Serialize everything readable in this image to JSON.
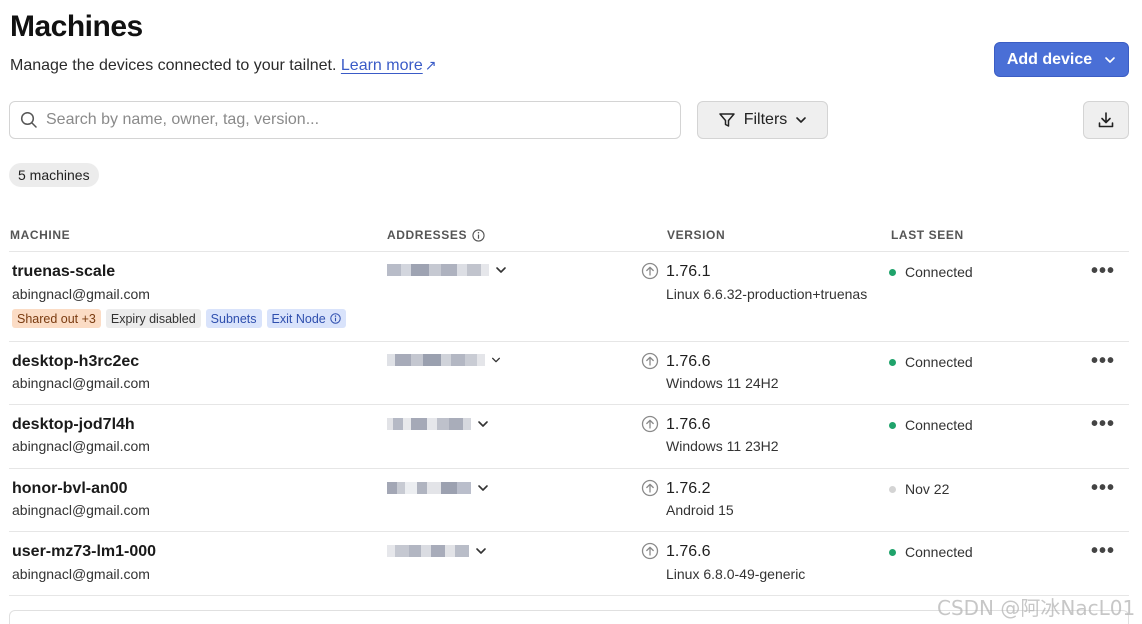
{
  "header": {
    "title": "Machines",
    "subtitle": "Manage the devices connected to your tailnet.",
    "learn_more": "Learn more",
    "learn_more_arrow": "↗",
    "add_device": "Add device"
  },
  "toolbar": {
    "search_placeholder": "Search by name, owner, tag, version...",
    "filters_label": "Filters"
  },
  "count_label": "5 machines",
  "columns": {
    "machine": "MACHINE",
    "addresses": "ADDRESSES",
    "version": "VERSION",
    "last_seen": "LAST SEEN"
  },
  "colors": {
    "accent": "#4a6fd6",
    "connected": "#1fa36b",
    "offline": "#d4d4d4"
  },
  "machines": [
    {
      "name": "truenas-scale",
      "owner": "abingnacl@gmail.com",
      "tags": [
        "Shared out +3",
        "Expiry disabled",
        "Subnets",
        "Exit Node"
      ],
      "version": "1.76.1",
      "os": "Linux 6.6.32-production+truenas",
      "last_seen": "Connected",
      "connected": true
    },
    {
      "name": "desktop-h3rc2ec",
      "owner": "abingnacl@gmail.com",
      "version": "1.76.6",
      "os": "Windows 11 24H2",
      "last_seen": "Connected",
      "connected": true
    },
    {
      "name": "desktop-jod7l4h",
      "owner": "abingnacl@gmail.com",
      "version": "1.76.6",
      "os": "Windows 11 23H2",
      "last_seen": "Connected",
      "connected": true
    },
    {
      "name": "honor-bvl-an00",
      "owner": "abingnacl@gmail.com",
      "version": "1.76.2",
      "os": "Android 15",
      "last_seen": "Nov 22",
      "connected": false
    },
    {
      "name": "user-mz73-lm1-000",
      "owner": "abingnacl@gmail.com",
      "version": "1.76.6",
      "os": "Linux 6.8.0-49-generic",
      "last_seen": "Connected",
      "connected": true
    }
  ],
  "watermark": "CSDN @阿冰NacL01"
}
